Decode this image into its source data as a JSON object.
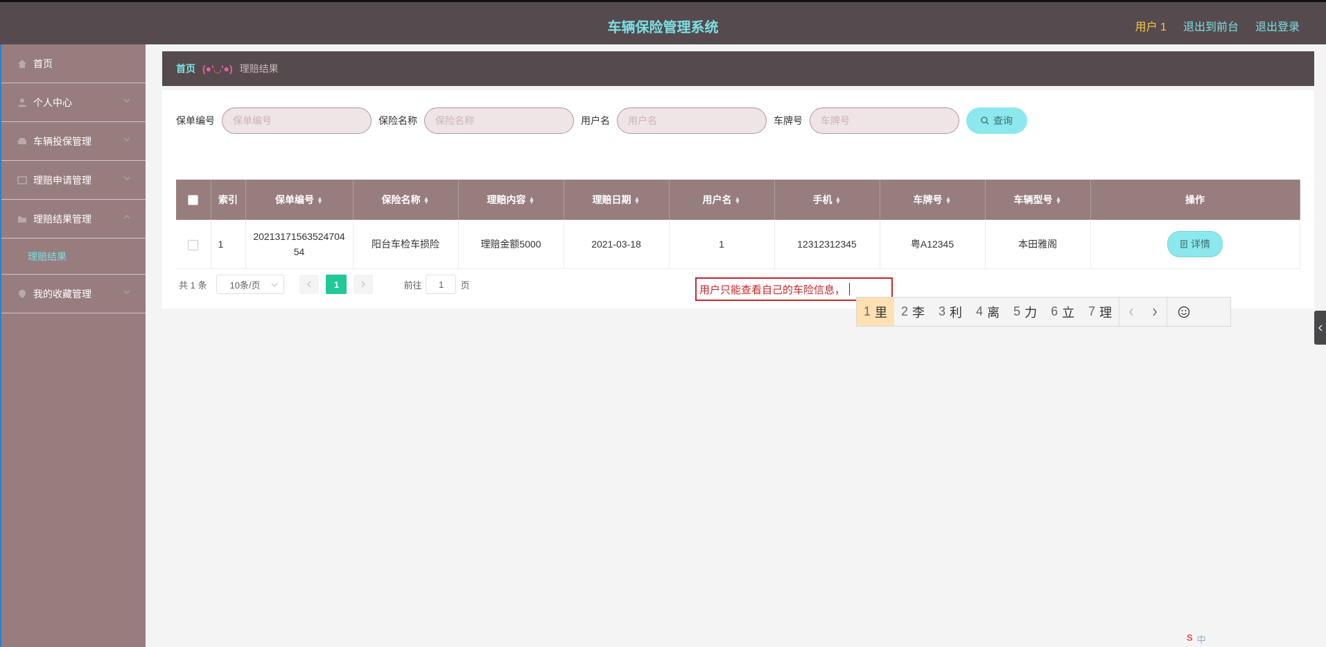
{
  "header": {
    "title": "车辆保险管理系统",
    "user": "用户 1",
    "back_front": "退出到前台",
    "logout": "退出登录"
  },
  "sidebar": {
    "items": [
      {
        "label": "首页",
        "icon": "home-icon"
      },
      {
        "label": "个人中心",
        "icon": "user-icon"
      },
      {
        "label": "车辆投保管理",
        "icon": "car-icon"
      },
      {
        "label": "理赔申请管理",
        "icon": "form-icon"
      },
      {
        "label": "理赔结果管理",
        "icon": "folder-icon"
      },
      {
        "label": "我的收藏管理",
        "icon": "location-icon"
      }
    ],
    "sub_item": "理赔结果"
  },
  "breadcrumb": {
    "home": "首页",
    "separator": "(●'◡'●)",
    "current": "理赔结果"
  },
  "search": {
    "policy_no_label": "保单编号",
    "policy_no_placeholder": "保单编号",
    "insurance_name_label": "保险名称",
    "insurance_name_placeholder": "保险名称",
    "username_label": "用户名",
    "username_placeholder": "用户名",
    "plate_label": "车牌号",
    "plate_placeholder": "车牌号",
    "query_button": "查询"
  },
  "table": {
    "headers": [
      "索引",
      "保单编号",
      "保险名称",
      "理赔内容",
      "理赔日期",
      "用户名",
      "手机",
      "车牌号",
      "车辆型号",
      "操作"
    ],
    "rows": [
      {
        "index": "1",
        "policy_no": "2021317156352470454",
        "insurance_name": "阳台车检车损险",
        "claim_content": "理赔金额5000",
        "claim_date": "2021-03-18",
        "username": "1",
        "phone": "12312312345",
        "plate": "粤A12345",
        "model": "本田雅阁",
        "action": "详情"
      }
    ]
  },
  "pagination": {
    "total": "共 1 条",
    "page_size": "10条/页",
    "current_page": "1",
    "goto_label": "前往",
    "goto_value": "1",
    "page_suffix": "页"
  },
  "annotation": {
    "text": "用户只能查看自己的车险信息，"
  },
  "ime": {
    "candidates": [
      {
        "n": "1",
        "c": "里"
      },
      {
        "n": "2",
        "c": "李"
      },
      {
        "n": "3",
        "c": "利"
      },
      {
        "n": "4",
        "c": "离"
      },
      {
        "n": "5",
        "c": "力"
      },
      {
        "n": "6",
        "c": "立"
      },
      {
        "n": "7",
        "c": "理"
      }
    ]
  },
  "tray": {
    "s": "S",
    "lang": "中"
  },
  "colors": {
    "topbar": "#554a4d",
    "sidebar": "#977d7e",
    "accent": "#7be0e4",
    "pager_active": "#20c997"
  }
}
